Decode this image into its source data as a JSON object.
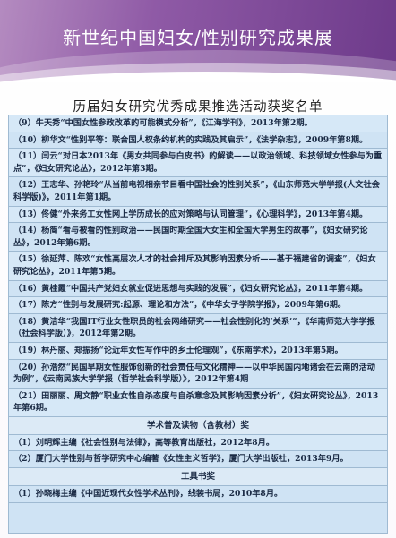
{
  "title": "新世纪中国妇女/性别研究成果展",
  "subtitle": "历届妇女研究优秀成果推选活动获奖名单",
  "entries_a": [
    "（9）牛天秀“中国女性参政改革的可能模式分析”，《江海学刊》，2013年第2期。",
    "（10）柳华文“性别平等：联合国人权条约机构的实践及其启示”，《法学杂志》，2009年第8期。",
    "（11）闫云“对日本2013年《男女共同参与白皮书》的解读——以政治领域、科技领域女性参与为重点”，《妇女研究论丛》，2012年第3期。",
    "（12）王志华、孙艳玲“从当前电视相亲节目看中国社会的性别关系”，《山东师范大学学报(人文社会科学版)》，2011年第1期。",
    "（13）佟健“外来务工女性网上学历成长的应对策略与认同管理”，《心理科学》，2013年第4期。",
    "（14）杨简“看与被看的性别政治——民国时期全国大女生和全国大学男生的故事”，《妇女研究论丛》，2012年第6期。",
    "（15）徐延萍、陈欢“女性高层次人才的社会排斥及其影响因素分析——基于福建省的调查”，《妇女研究论丛》，2011年第5期。",
    "（16）黄桂霞“中国共产党妇女就业促进思想与实践的发展”，《妇女研究论丛》，2011年第4期。",
    "（17）陈方“性别与发展研究:起源、理论和方法”，《中华女子学院学报》，2009年第6期。",
    "（18）黄洁华“我国IT行业女性职员的社会网络研究——社会性别化的‘关系’”，《华南师范大学学报（社会科学版）》，2012年第2期。",
    "（19）林丹丽、郑振扬“论近年女性写作中的乡土伦理观”，《东南学术》，2013年第5期。",
    "（20）孙浩然“民国早期女性服饰创新的社会责任与文化精神——以中华民国内地诸会在云南的活动为例”，《云南民族大学学报（哲学社会科学版）》，2012年第4期",
    "（21）田丽丽、周文静“职业女性自杀态度与自杀意念及其影响因素分析”，《妇女研究论丛》，2013年第6期。"
  ],
  "section_b": "学术普及读物（含教材）奖",
  "entries_b": [
    "（1）刘明辉主编《社会性别与法律》，高等教育出版社，2012年8月。",
    "（2）厦门大学性别与哲学研究中心编著《女性主义哲学》，厦门大学出版社，2013年9月。"
  ],
  "section_c": "工具书奖",
  "entries_c": [
    "（1）孙晓梅主编《中国近现代女性学术丛刊》，线装书局，2010年8月。"
  ]
}
